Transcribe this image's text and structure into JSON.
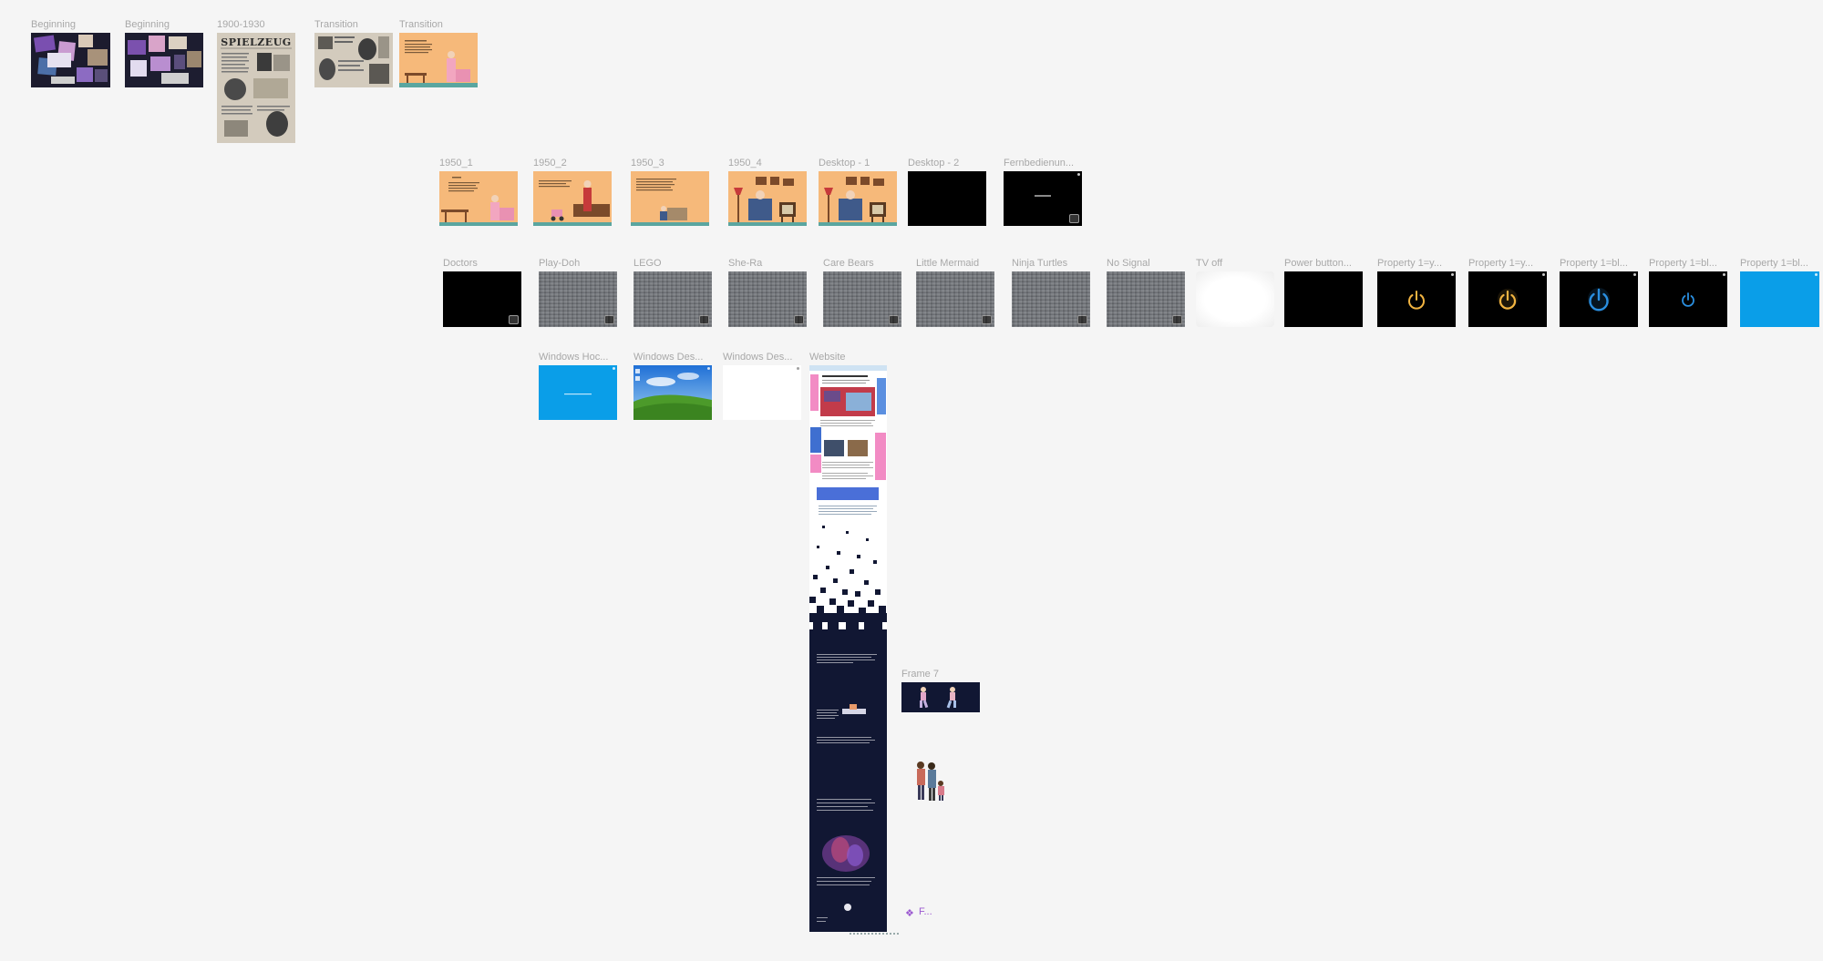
{
  "canvas": {
    "row1": [
      {
        "id": "f-beginning-1",
        "label": "Beginning"
      },
      {
        "id": "f-beginning-2",
        "label": "Beginning"
      },
      {
        "id": "f-1900-1930",
        "label": "1900-1930",
        "heading": "SPIELZEUG"
      },
      {
        "id": "f-transition-1",
        "label": "Transition"
      },
      {
        "id": "f-transition-2",
        "label": "Transition"
      }
    ],
    "row2": [
      {
        "id": "f-1950-1",
        "label": "1950_1"
      },
      {
        "id": "f-1950-2",
        "label": "1950_2"
      },
      {
        "id": "f-1950-3",
        "label": "1950_3"
      },
      {
        "id": "f-1950-4",
        "label": "1950_4"
      },
      {
        "id": "f-desktop-1",
        "label": "Desktop - 1"
      },
      {
        "id": "f-desktop-2",
        "label": "Desktop - 2"
      },
      {
        "id": "f-fernbedienung",
        "label": "Fernbedienun..."
      }
    ],
    "row3": [
      {
        "id": "f-doctors",
        "label": "Doctors"
      },
      {
        "id": "f-playdoh",
        "label": "Play-Doh"
      },
      {
        "id": "f-lego",
        "label": "LEGO"
      },
      {
        "id": "f-shera",
        "label": "She-Ra"
      },
      {
        "id": "f-carebears",
        "label": "Care Bears"
      },
      {
        "id": "f-littlemermaid",
        "label": "Little Mermaid"
      },
      {
        "id": "f-ninjaturtles",
        "label": "Ninja Turtles"
      },
      {
        "id": "f-nosignal",
        "label": "No Signal"
      },
      {
        "id": "f-tvoff",
        "label": "TV off"
      },
      {
        "id": "f-powerbutton",
        "label": "Power button..."
      },
      {
        "id": "f-prop-y1",
        "label": "Property 1=y..."
      },
      {
        "id": "f-prop-y2",
        "label": "Property 1=y..."
      },
      {
        "id": "f-prop-bl1",
        "label": "Property 1=bl..."
      },
      {
        "id": "f-prop-bl2",
        "label": "Property 1=bl..."
      },
      {
        "id": "f-prop-bl3",
        "label": "Property 1=bl..."
      }
    ],
    "row4": [
      {
        "id": "f-win-hoc",
        "label": "Windows Hoc..."
      },
      {
        "id": "f-win-des1",
        "label": "Windows Des..."
      },
      {
        "id": "f-win-des2",
        "label": "Windows Des..."
      },
      {
        "id": "f-website",
        "label": "Website"
      }
    ],
    "frame7": {
      "label": "Frame 7"
    },
    "component_label": "F...",
    "colors": {
      "canvas_bg": "#f5f5f5",
      "label": "#a8a8a8",
      "peach": "#f6b97a",
      "teal_floor": "#5aa6a0",
      "navy": "#111733",
      "windows_blue": "#0a9ee8",
      "power_yellow": "#f2b441",
      "power_blue": "#2a8fe0",
      "component_purple": "#9b59d0"
    }
  }
}
